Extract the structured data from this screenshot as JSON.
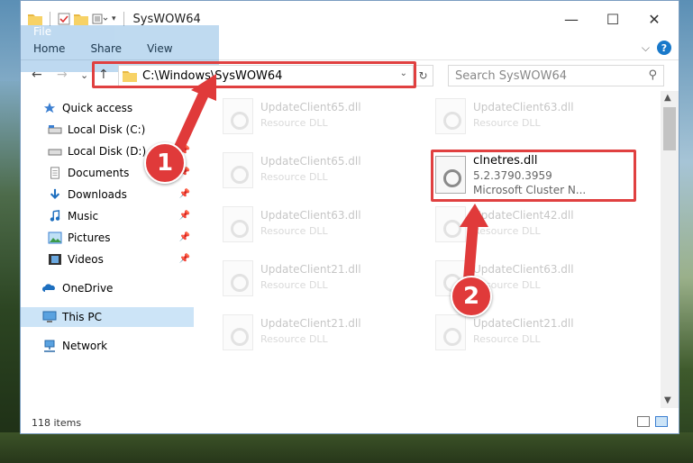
{
  "window": {
    "title": "SysWOW64",
    "minimize_glyph": "—",
    "maximize_glyph": "☐",
    "close_glyph": "✕"
  },
  "ribbon": {
    "tabs": [
      "File",
      "Home",
      "Share",
      "View"
    ],
    "expand_glyph": "⌵",
    "help_glyph": "?"
  },
  "navigation": {
    "back_glyph": "←",
    "forward_glyph": "→",
    "recent_glyph": "⌄",
    "up_glyph": "↑",
    "address": "C:\\Windows\\SysWOW64",
    "address_dropdown_glyph": "⌄",
    "refresh_glyph": "↻",
    "search_placeholder": "Search SysWOW64",
    "search_glyph": "⚲"
  },
  "sidebar": {
    "items": [
      {
        "label": "Quick access",
        "icon": "star-icon",
        "pinned": false
      },
      {
        "label": "Local Disk (C:)",
        "icon": "drive-icon",
        "pinned": false
      },
      {
        "label": "Local Disk (D:)",
        "icon": "drive-icon",
        "pinned": true
      },
      {
        "label": "Documents",
        "icon": "documents-icon",
        "pinned": true
      },
      {
        "label": "Downloads",
        "icon": "downloads-icon",
        "pinned": true
      },
      {
        "label": "Music",
        "icon": "music-icon",
        "pinned": true
      },
      {
        "label": "Pictures",
        "icon": "pictures-icon",
        "pinned": true
      },
      {
        "label": "Videos",
        "icon": "videos-icon",
        "pinned": true
      },
      {
        "label": "OneDrive",
        "icon": "onedrive-icon",
        "pinned": false
      },
      {
        "label": "This PC",
        "icon": "computer-icon",
        "pinned": false,
        "selected": true
      },
      {
        "label": "Network",
        "icon": "network-icon",
        "pinned": false
      }
    ],
    "pin_glyph": "📌"
  },
  "files": [
    {
      "name": "UpdateClient65.dll",
      "desc": "Resource DLL"
    },
    {
      "name": "UpdateClient63.dll",
      "desc": "Resource DLL"
    },
    {
      "name": "UpdateClient65.dll",
      "desc": "Resource DLL"
    },
    {
      "name": "UpdateClient63.dll",
      "desc": "Resource DLL"
    },
    {
      "name": "UpdateClient42.dll",
      "desc": "Resource DLL"
    },
    {
      "name": "UpdateClient21.dll",
      "desc": "Resource DLL"
    },
    {
      "name": "UpdateClient63.dll",
      "desc": "Resource DLL"
    },
    {
      "name": "UpdateClient21.dll",
      "desc": "Resource DLL"
    },
    {
      "name": "UpdateClient21.dll",
      "desc": "Resource DLL"
    }
  ],
  "highlighted_file": {
    "name": "clnetres.dll",
    "version": "5.2.3790.3959",
    "desc": "Microsoft Cluster N..."
  },
  "status": {
    "items_count": "118 items"
  },
  "annotations": {
    "badge1": "1",
    "badge2": "2",
    "highlight_color": "#e04040"
  },
  "colors": {
    "accent": "#1979ca",
    "selection": "#cce4f7"
  }
}
